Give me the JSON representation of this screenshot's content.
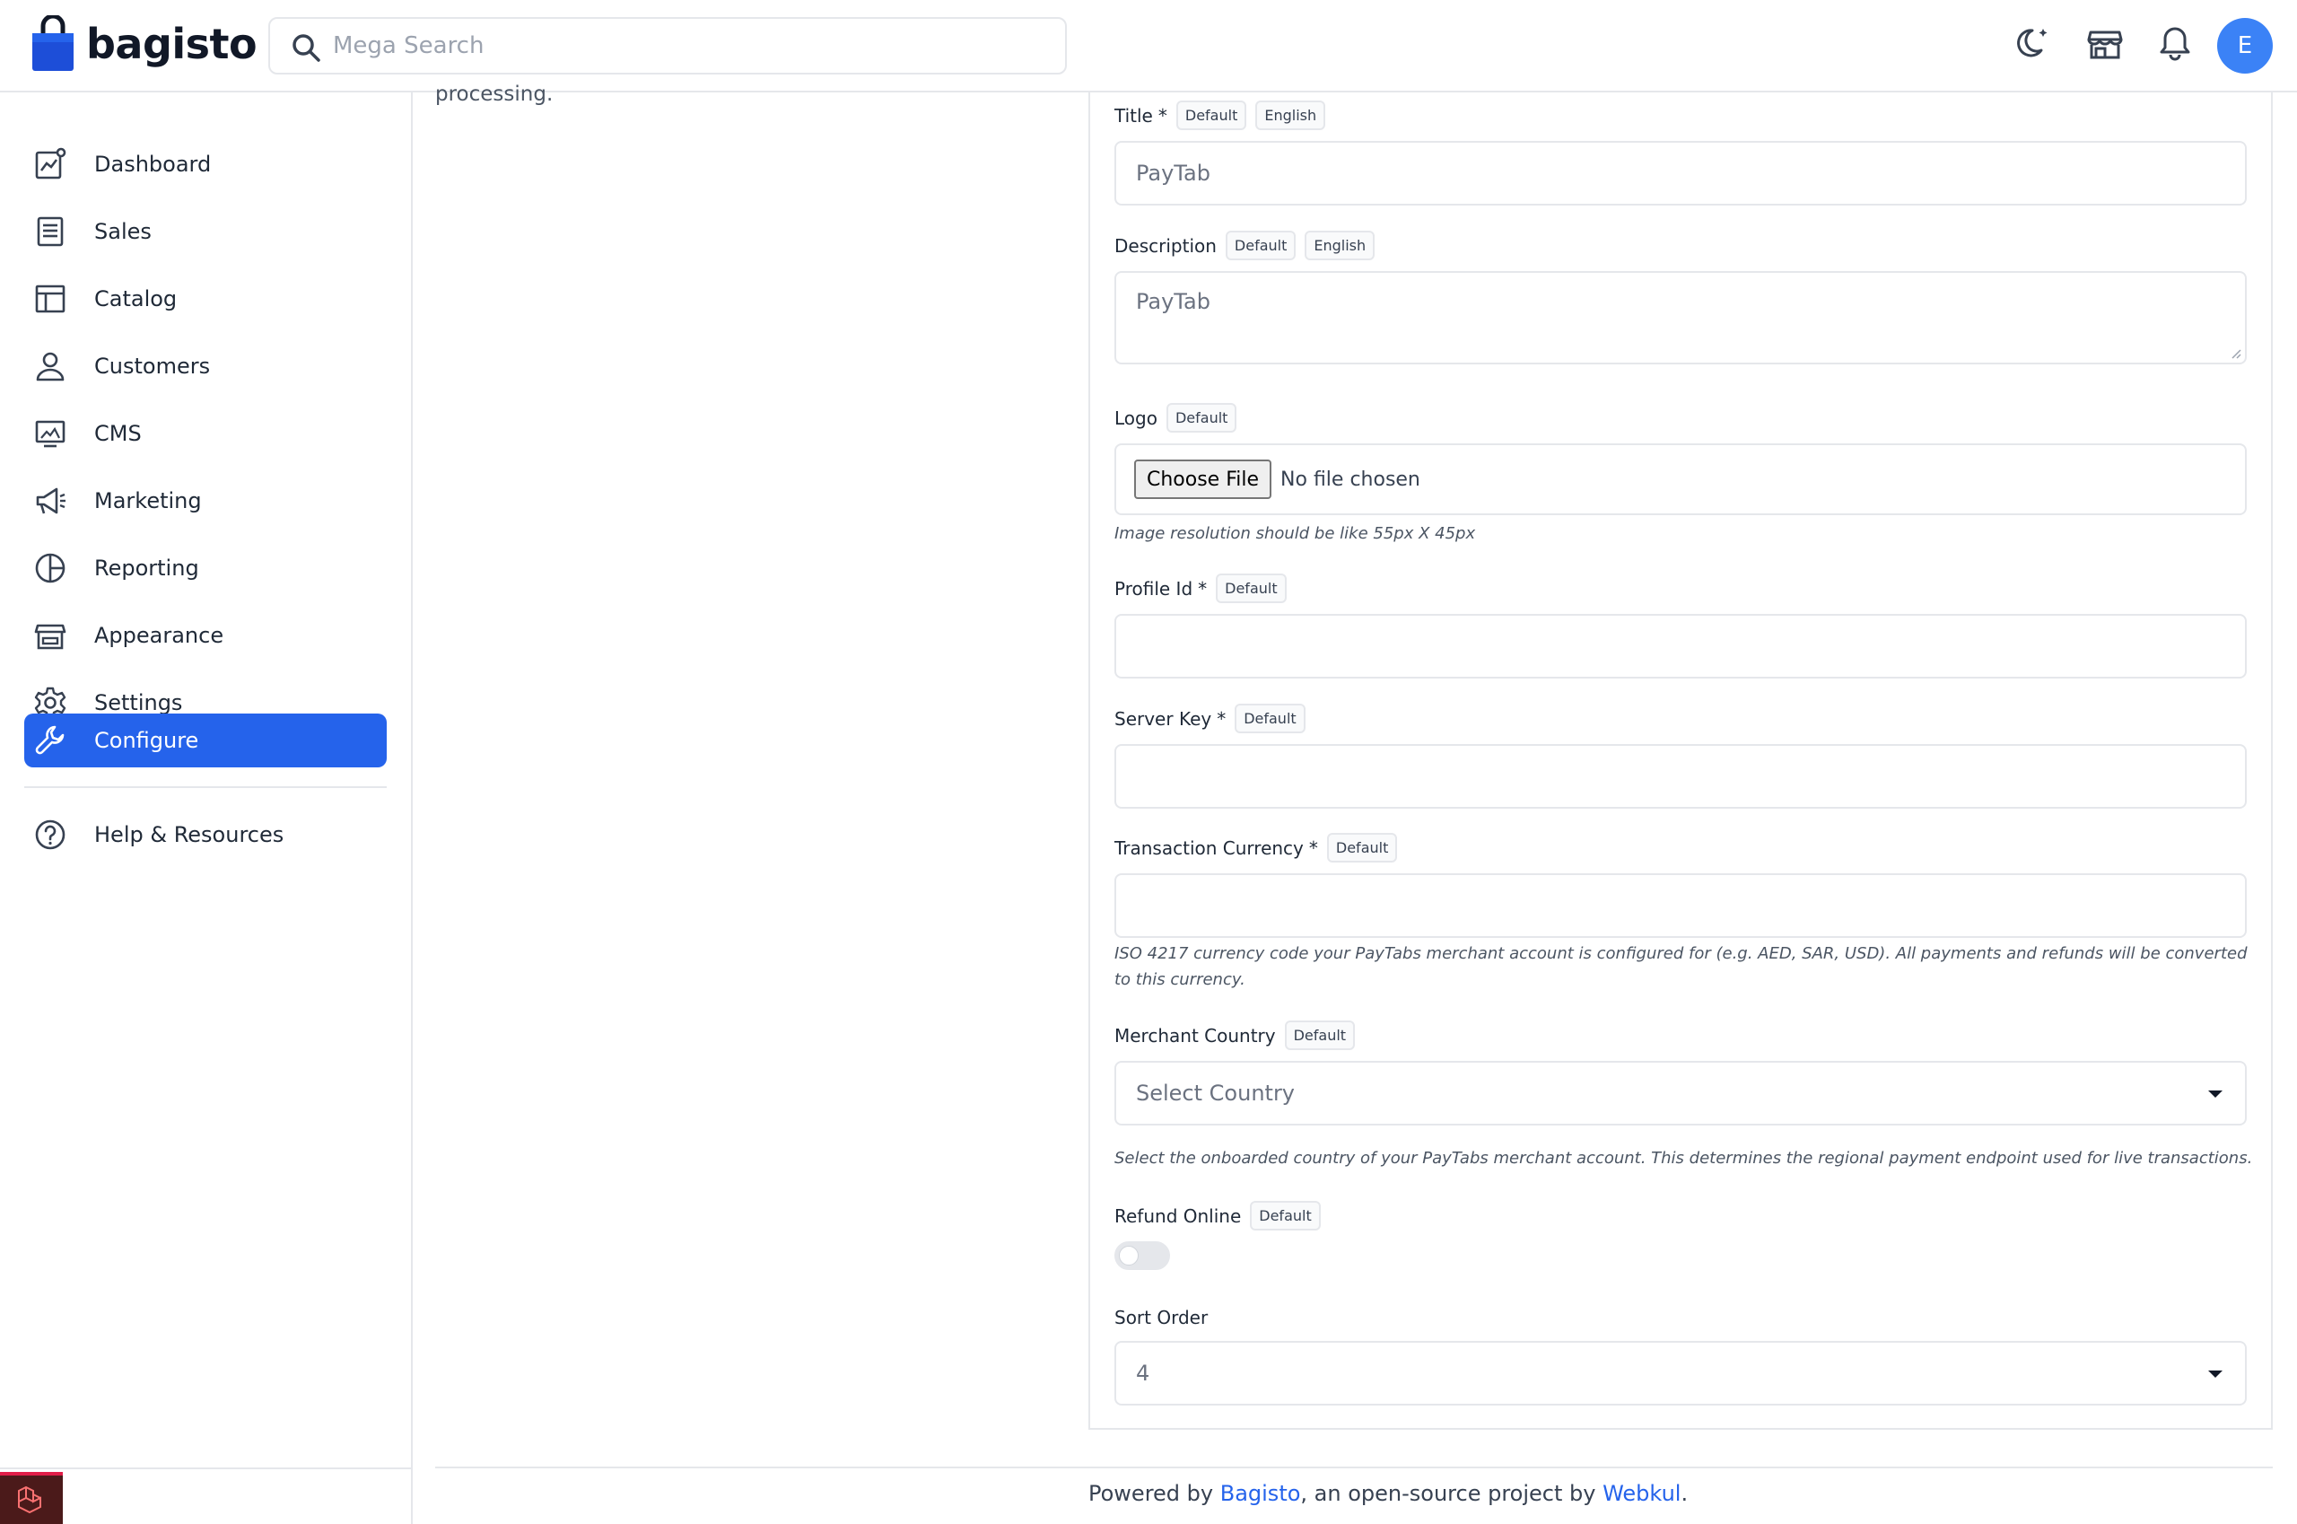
{
  "header": {
    "brand": "bagisto",
    "search_placeholder": "Mega Search",
    "avatar_initial": "E"
  },
  "sidebar": {
    "items": [
      {
        "label": "Dashboard",
        "icon": "dashboard-icon"
      },
      {
        "label": "Sales",
        "icon": "sales-icon"
      },
      {
        "label": "Catalog",
        "icon": "catalog-icon"
      },
      {
        "label": "Customers",
        "icon": "customers-icon"
      },
      {
        "label": "CMS",
        "icon": "cms-icon"
      },
      {
        "label": "Marketing",
        "icon": "marketing-icon"
      },
      {
        "label": "Reporting",
        "icon": "reporting-icon"
      },
      {
        "label": "Appearance",
        "icon": "appearance-icon"
      },
      {
        "label": "Settings",
        "icon": "settings-icon"
      },
      {
        "label": "Configure",
        "icon": "configure-icon",
        "active": true
      }
    ],
    "help": {
      "label": "Help & Resources",
      "icon": "help-icon"
    }
  },
  "main": {
    "cut_text": "processing.",
    "badge_default": "Default",
    "badge_english": "English",
    "title": {
      "label": "Title",
      "required": "*",
      "value": "PayTab"
    },
    "description": {
      "label": "Description",
      "value": "PayTab"
    },
    "logo": {
      "label": "Logo",
      "button": "Choose File",
      "status": "No file chosen",
      "hint": "Image resolution should be like 55px X 45px"
    },
    "profile_id": {
      "label": "Profile Id",
      "required": "*",
      "value": ""
    },
    "server_key": {
      "label": "Server Key",
      "required": "*",
      "value": ""
    },
    "transaction_currency": {
      "label": "Transaction Currency",
      "required": "*",
      "value": "",
      "hint": "ISO 4217 currency code your PayTabs merchant account is configured for (e.g. AED, SAR, USD). All payments and refunds will be converted to this currency."
    },
    "merchant_country": {
      "label": "Merchant Country",
      "selected": "Select Country",
      "hint": "Select the onboarded country of your PayTabs merchant account. This determines the regional payment endpoint used for live transactions."
    },
    "refund_online": {
      "label": "Refund Online",
      "enabled": false
    },
    "sort_order": {
      "label": "Sort Order",
      "selected": "4"
    }
  },
  "footer": {
    "prefix": "Powered by ",
    "link1": "Bagisto",
    "middle": ", an open-source project by ",
    "link2": "Webkul",
    "suffix": "."
  },
  "colors": {
    "accent": "#2563eb",
    "avatar": "#3b82f6",
    "border": "#e5e7eb"
  }
}
